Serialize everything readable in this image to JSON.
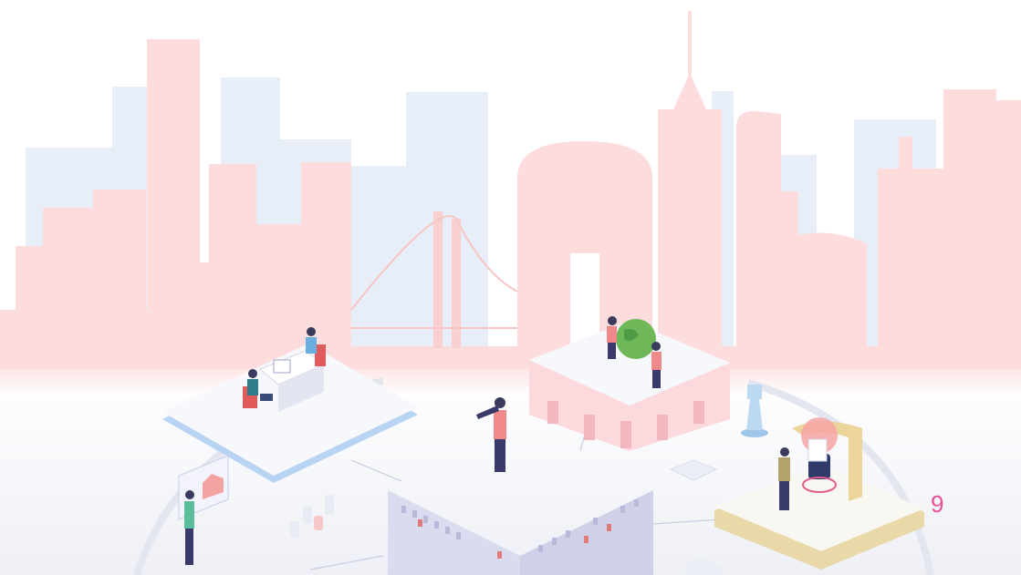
{
  "page": {
    "number": "9"
  },
  "colors": {
    "skyline_pink": "#fcdcdc",
    "skyline_blue": "#e6eef8",
    "ground": "#f2f3f8",
    "platform": "#f7f8fc",
    "building_gray": "#d9dbee",
    "accent_pink": "#e8509a",
    "globe_green": "#6fb85a",
    "platform_blue_edge": "#b9d4f3",
    "platform_gold_edge": "#e9d8a8"
  },
  "illustration": {
    "icons": [
      "city-skyline",
      "bridge",
      "gear-platform",
      "globe",
      "chess-rook",
      "telescope",
      "lightbulb",
      "laptop",
      "desk",
      "chart-board"
    ]
  }
}
